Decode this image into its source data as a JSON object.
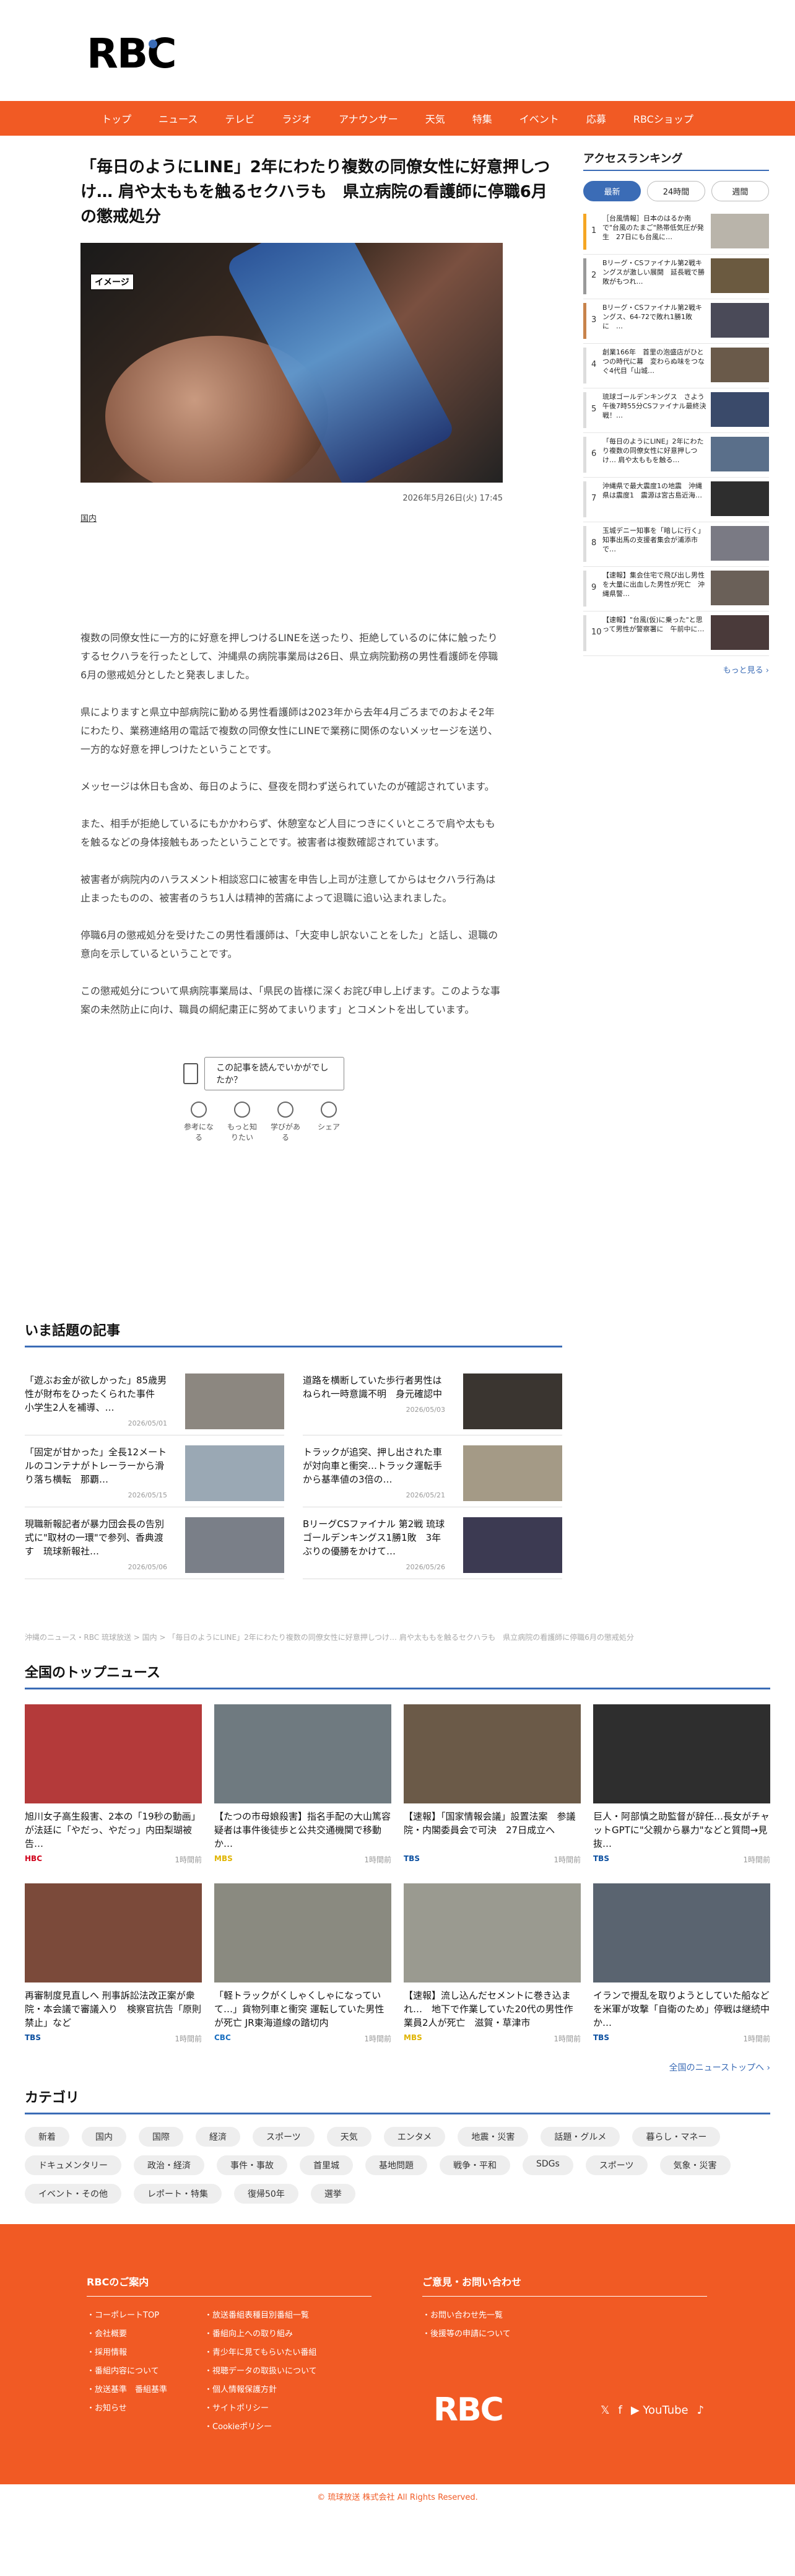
{
  "header": {
    "logo": "RBC"
  },
  "nav": [
    "トップ",
    "ニュース",
    "テレビ",
    "ラジオ",
    "アナウンサー",
    "天気",
    "特集",
    "イベント",
    "応募",
    "RBCショップ"
  ],
  "article": {
    "title": "「毎日のようにLINE」2年にわたり複数の同僚女性に好意押しつけ… 肩や太ももを触るセクハラも　県立病院の看護師に停職6月の懲戒処分",
    "image_badge": "イメージ",
    "date": "2026年5月26日(火) 17:45",
    "category": "国内",
    "paragraphs": [
      "複数の同僚女性に一方的に好意を押しつけるLINEを送ったり、拒絶しているのに体に触ったりするセクハラを行ったとして、沖縄県の病院事業局は26日、県立病院勤務の男性看護師を停職6月の懲戒処分としたと発表しました。",
      "県によりますと県立中部病院に勤める男性看護師は2023年から去年4月ごろまでのおよそ2年にわたり、業務連絡用の電話で複数の同僚女性にLINEで業務に関係のないメッセージを送り、一方的な好意を押しつけたということです。",
      "メッセージは休日も含め、毎日のように、昼夜を問わず送られていたのが確認されています。",
      "また、相手が拒絶しているにもかかわらず、休憩室など人目につきにくいところで肩や太ももを触るなどの身体接触もあったということです。被害者は複数確認されています。",
      "被害者が病院内のハラスメント相談窓口に被害を申告し上司が注意してからはセクハラ行為は止まったものの、被害者のうち1人は精神的苦痛によって退職に追い込まれました。",
      "停職6月の懲戒処分を受けたこの男性看護師は、「大変申し訳ないことをした」と話し、退職の意向を示しているということです。",
      "この懲戒処分について県病院事業局は、「県民の皆様に深くお詫び申し上げます。このような事案の未然防止に向け、職員の綱紀粛正に努めてまいります」とコメントを出しています。"
    ]
  },
  "survey": {
    "question": "この記事を読んでいかがでしたか？",
    "buttons": [
      "参考になる",
      "もっと知りたい",
      "学びがある",
      "シェア"
    ]
  },
  "hot": {
    "title": "いま話題の記事",
    "items": [
      {
        "text": "「遊ぶお金が欲しかった」85歳男性が財布をひったくられた事件　小学生2人を補導、…",
        "date": "2026/05/01"
      },
      {
        "text": "道路を横断していた歩行者男性はねられ一時意識不明　身元確認中",
        "date": "2026/05/03"
      },
      {
        "text": "「固定が甘かった」全長12メートルのコンテナがトレーラーから滑り落ち横転　那覇…",
        "date": "2026/05/15"
      },
      {
        "text": "トラックが追突、押し出された車が対向車と衝突…トラック運転手から基準値の3倍の…",
        "date": "2026/05/21"
      },
      {
        "text": "現職新報記者が暴力団会長の告別式に\"取材の一環\"で参列、香典渡す　琉球新報社…",
        "date": "2026/05/06"
      },
      {
        "text": "BリーグCSファイナル 第2戦 琉球ゴールデンキングス1勝1敗　3年ぶりの優勝をかけて…",
        "date": "2026/05/26"
      }
    ]
  },
  "breadcrumb": "沖縄のニュース・RBC 琉球放送 > 国内 > 「毎日のようにLINE」2年にわたり複数の同僚女性に好意押しつけ… 肩や太ももを触るセクハラも　県立病院の看護師に停職6月の懲戒処分",
  "top_news": {
    "title": "全国のトップニュース",
    "items": [
      {
        "text": "旭川女子高生殺害、2本の「19秒の動画」が法廷に「やだっ、やだっ」内田梨瑚被告…",
        "source": "HBC",
        "time": "1時間前"
      },
      {
        "text": "【たつの市母娘殺害】指名手配の大山篤容疑者は事件後徒歩と公共交通機関で移動か…",
        "source": "MBS",
        "time": "1時間前"
      },
      {
        "text": "【速報】「国家情報会議」設置法案　参議院・内閣委員会で可決　27日成立へ",
        "source": "TBS",
        "time": "1時間前"
      },
      {
        "text": "巨人・阿部慎之助監督が辞任…長女がチャットGPTに\"父親から暴力\"などと質問→見抜…",
        "source": "TBS",
        "time": "1時間前"
      },
      {
        "text": "再審制度見直しへ 刑事訴訟法改正案が衆院・本会議で審議入り　検察官抗告「原則禁止」など",
        "source": "TBS",
        "time": "1時間前"
      },
      {
        "text": "「軽トラックがくしゃくしゃになっていて…」貨物列車と衝突 運転していた男性が死亡 JR東海道線の踏切内",
        "source": "CBC",
        "time": "1時間前"
      },
      {
        "text": "【速報】流し込んだセメントに巻き込まれ…　地下で作業していた20代の男性作業員2人が死亡　滋賀・草津市",
        "source": "MBS",
        "time": "1時間前"
      },
      {
        "text": "イランで攪乱を取りようとしていた船などを米軍が攻撃「自衛のため」停戦は継続中か…",
        "source": "TBS",
        "time": "1時間前"
      }
    ],
    "more": "全国のニューストップへ ›"
  },
  "categories": {
    "title": "カテゴリ",
    "items": [
      "新着",
      "国内",
      "国際",
      "経済",
      "スポーツ",
      "天気",
      "エンタメ",
      "地震・災害",
      "話題・グルメ",
      "暮らし・マネー",
      "ドキュメンタリー",
      "政治・経済",
      "事件・事故",
      "首里城",
      "基地問題",
      "戦争・平和",
      "SDGs",
      "スポーツ",
      "気象・災害",
      "イベント・その他",
      "レポート・特集",
      "復帰50年",
      "選挙"
    ]
  },
  "footer": {
    "guide_title": "RBCのご案内",
    "guide_col1": [
      "コーポレートTOP",
      "会社概要",
      "採用情報",
      "番組内容について",
      "放送基準　番組基準",
      "お知らせ"
    ],
    "guide_col2": [
      "放送番組表種目別番組一覧",
      "番組向上への取り組み",
      "青少年に見てもらいたい番組",
      "視聴データの取扱いについて",
      "個人情報保護方針",
      "サイトポリシー",
      "Cookieポリシー"
    ],
    "contact_title": "ご意見・お問い合わせ",
    "contact": [
      "お問い合わせ先一覧",
      "後援等の申請について"
    ],
    "logo": "RBC",
    "social": [
      "𝕏",
      "f",
      "▶ YouTube",
      "♪"
    ],
    "copyright": "© 琉球放送 株式会社 All Rights Reserved."
  },
  "ranking": {
    "title": "アクセスランキング",
    "tabs": [
      "最新",
      "24時間",
      "週間"
    ],
    "items": [
      {
        "num": "1",
        "text": "［台風情報］日本のはるか南で\"台風のたまご\"熱帯低気圧が発生　27日にも台風に…",
        "color": "#f5a623"
      },
      {
        "num": "2",
        "text": "Bリーグ・CSファイナル第2戦キングスが激しい展開　延長戦で勝敗がもつれ…",
        "color": "#999"
      },
      {
        "num": "3",
        "text": "Bリーグ・CSファイナル第2戦キングス、64-72で敗れ1勝1敗に　…",
        "color": "#c8834b"
      },
      {
        "num": "4",
        "text": "創業166年　首里の泡盛店がひとつの時代に幕　変わらぬ味をつなぐ4代目「山城…",
        "color": "#ddd"
      },
      {
        "num": "5",
        "text": "琉球ゴールデンキングス　さよう午後7時55分CSファイナル最終決戦！…",
        "color": "#ddd"
      },
      {
        "num": "6",
        "text": "「毎日のようにLINE」2年にわたり複数の同僚女性に好意押しつけ… 肩や太ももを触る…",
        "color": "#ddd"
      },
      {
        "num": "7",
        "text": "沖縄県で最大震度1の地震　沖縄県は震度1　震源は宮古島近海…",
        "color": "#ddd"
      },
      {
        "num": "8",
        "text": "玉城デニー知事を「暗しに行く」知事出馬の支援者集会が浦添市で…",
        "color": "#ddd"
      },
      {
        "num": "9",
        "text": "【速報】集会住宅で飛び出し男性を大量に出血した男性が死亡　沖縄県警…",
        "color": "#ddd"
      },
      {
        "num": "10",
        "text": "【速報】\"台風(仮)に乗った\"と思って男性が警察署に　午前中に…",
        "color": "#ddd"
      }
    ],
    "more": "もっと見る ›"
  }
}
